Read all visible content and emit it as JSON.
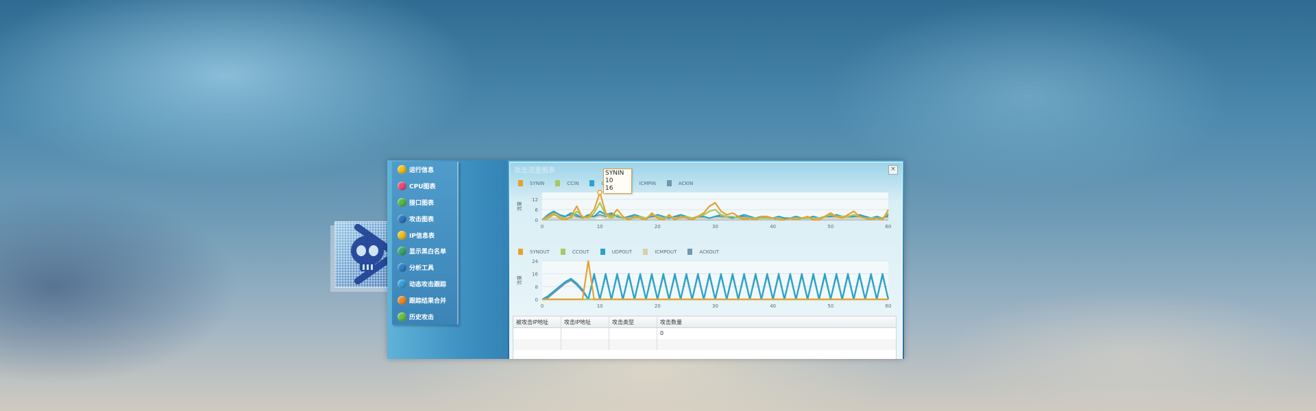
{
  "sidebar": {
    "items": [
      {
        "label": "运行信息",
        "icon": "run-info-icon",
        "color": "#f0c020"
      },
      {
        "label": "CPU图表",
        "icon": "cpu-chart-icon",
        "color": "#e0507a"
      },
      {
        "label": "接口图表",
        "icon": "interface-chart-icon",
        "color": "#58b848"
      },
      {
        "label": "攻击图表",
        "icon": "attack-chart-icon",
        "color": "#2f78c0"
      },
      {
        "label": "IP信息表",
        "icon": "ip-table-icon",
        "color": "#f0c020"
      },
      {
        "label": "显示黑白名单",
        "icon": "blacklist-icon",
        "color": "#3aa86a"
      },
      {
        "label": "分析工具",
        "icon": "analysis-tool-icon",
        "color": "#2f7fc8"
      },
      {
        "label": "动态攻击跟踪",
        "icon": "attack-tracking-icon",
        "color": "#3aa0d8"
      },
      {
        "label": "跟踪结果合并",
        "icon": "merge-results-icon",
        "color": "#f08a28"
      },
      {
        "label": "历史攻击",
        "icon": "history-attack-icon",
        "color": "#6cc040"
      }
    ]
  },
  "panel": {
    "title": "攻击流量图表",
    "close": "×"
  },
  "tooltip": {
    "series": "SYNIN",
    "x": "10",
    "y": "16"
  },
  "colors": {
    "orange": "#e8a030",
    "green": "#a8c860",
    "cyan": "#28a4cc",
    "beige": "#d8d0a8",
    "slate": "#6f98ae"
  },
  "chart_data": [
    {
      "type": "line",
      "title": "",
      "ylabel": "流量",
      "xlim": [
        0,
        60
      ],
      "ylim": [
        0,
        16
      ],
      "yticks": [
        0,
        6,
        12
      ],
      "xticks": [
        0,
        10,
        20,
        30,
        40,
        50,
        60
      ],
      "x": [
        0,
        1,
        2,
        3,
        4,
        5,
        6,
        7,
        8,
        9,
        10,
        11,
        12,
        13,
        14,
        15,
        16,
        17,
        18,
        19,
        20,
        21,
        22,
        23,
        24,
        25,
        26,
        27,
        28,
        29,
        30,
        31,
        32,
        33,
        34,
        35,
        36,
        37,
        38,
        39,
        40,
        41,
        42,
        43,
        44,
        45,
        46,
        47,
        48,
        49,
        50,
        51,
        52,
        53,
        54,
        55,
        56,
        57,
        58,
        59,
        60
      ],
      "series": [
        {
          "name": "SYNIN",
          "color": "#e8a030",
          "values": [
            0,
            2,
            4,
            1,
            0,
            2,
            8,
            1,
            2,
            6,
            16,
            4,
            2,
            6,
            2,
            0,
            2,
            1,
            0,
            4,
            1,
            0,
            3,
            0,
            2,
            1,
            0,
            2,
            4,
            8,
            10,
            5,
            3,
            4,
            2,
            0,
            1,
            0,
            2,
            2,
            1,
            0,
            0,
            1,
            0,
            1,
            2,
            0,
            0,
            2,
            4,
            2,
            1,
            3,
            5,
            2,
            1,
            0,
            1,
            0,
            6
          ]
        },
        {
          "name": "CCIN",
          "color": "#a8c860",
          "values": [
            0,
            1,
            3,
            2,
            1,
            1,
            5,
            2,
            1,
            4,
            10,
            3,
            1,
            3,
            1,
            1,
            1,
            2,
            1,
            3,
            2,
            1,
            2,
            1,
            1,
            2,
            1,
            2,
            3,
            5,
            6,
            3,
            2,
            2,
            1,
            1,
            1,
            1,
            1,
            1,
            1,
            1,
            0,
            1,
            1,
            1,
            1,
            1,
            1,
            2,
            3,
            2,
            2,
            2,
            3,
            2,
            1,
            1,
            1,
            1,
            4
          ]
        },
        {
          "name": "UDPIN",
          "color": "#28a4cc",
          "values": [
            0,
            3,
            5,
            3,
            2,
            4,
            3,
            1,
            3,
            2,
            5,
            3,
            4,
            2,
            1,
            2,
            3,
            2,
            1,
            2,
            3,
            2,
            1,
            2,
            3,
            2,
            1,
            2,
            2,
            1,
            2,
            3,
            2,
            1,
            2,
            3,
            2,
            1,
            2,
            1,
            1,
            2,
            1,
            1,
            2,
            1,
            1,
            2,
            1,
            2,
            2,
            3,
            2,
            2,
            2,
            3,
            2,
            1,
            2,
            1,
            3
          ]
        },
        {
          "name": "ICMPIN",
          "color": "#d8d0a8",
          "values": [
            0,
            1,
            1,
            1,
            1,
            1,
            1,
            1,
            1,
            1,
            2,
            1,
            1,
            1,
            1,
            1,
            1,
            1,
            1,
            1,
            1,
            1,
            1,
            1,
            1,
            1,
            1,
            1,
            1,
            1,
            1,
            1,
            1,
            1,
            1,
            1,
            1,
            1,
            1,
            1,
            1,
            1,
            1,
            1,
            1,
            1,
            1,
            1,
            1,
            1,
            1,
            1,
            1,
            1,
            1,
            1,
            1,
            1,
            1,
            1,
            1
          ]
        },
        {
          "name": "ACKIN",
          "color": "#6f98ae",
          "values": [
            0,
            2,
            3,
            2,
            2,
            3,
            2,
            1,
            2,
            2,
            3,
            2,
            3,
            2,
            1,
            2,
            2,
            1,
            1,
            2,
            2,
            1,
            1,
            2,
            2,
            1,
            1,
            2,
            1,
            1,
            2,
            2,
            1,
            1,
            2,
            2,
            1,
            1,
            2,
            1,
            1,
            2,
            1,
            1,
            2,
            1,
            1,
            2,
            1,
            2,
            2,
            2,
            2,
            1,
            2,
            2,
            2,
            1,
            1,
            1,
            2
          ]
        }
      ]
    },
    {
      "type": "line",
      "title": "",
      "ylabel": "流量",
      "xlim": [
        0,
        60
      ],
      "ylim": [
        0,
        24
      ],
      "yticks": [
        0,
        8,
        16,
        24
      ],
      "xticks": [
        0,
        10,
        20,
        30,
        40,
        50,
        60
      ],
      "x": [
        0,
        1,
        2,
        3,
        4,
        5,
        6,
        7,
        8,
        9,
        10,
        11,
        12,
        13,
        14,
        15,
        16,
        17,
        18,
        19,
        20,
        21,
        22,
        23,
        24,
        25,
        26,
        27,
        28,
        29,
        30,
        31,
        32,
        33,
        34,
        35,
        36,
        37,
        38,
        39,
        40,
        41,
        42,
        43,
        44,
        45,
        46,
        47,
        48,
        49,
        50,
        51,
        52,
        53,
        54,
        55,
        56,
        57,
        58,
        59,
        60
      ],
      "series": [
        {
          "name": "SYNOUT",
          "color": "#e8a030",
          "values": [
            0,
            0,
            0,
            0,
            0,
            0,
            0,
            0,
            24,
            0,
            0,
            0,
            0,
            0,
            0,
            0,
            0,
            0,
            0,
            0,
            0,
            0,
            0,
            0,
            0,
            0,
            0,
            0,
            0,
            0,
            0,
            0,
            0,
            0,
            0,
            0,
            0,
            0,
            0,
            0,
            0,
            0,
            0,
            0,
            0,
            0,
            0,
            0,
            0,
            0,
            0,
            0,
            0,
            0,
            0,
            0,
            0,
            0,
            0,
            0,
            0
          ]
        },
        {
          "name": "CCOUT",
          "color": "#a8c860",
          "values": [
            0,
            0,
            0,
            0,
            0,
            0,
            0,
            0,
            0,
            0,
            0,
            0,
            0,
            0,
            0,
            0,
            0,
            0,
            0,
            0,
            0,
            0,
            0,
            0,
            0,
            0,
            0,
            0,
            0,
            0,
            0,
            0,
            0,
            0,
            0,
            0,
            0,
            0,
            0,
            0,
            0,
            0,
            0,
            0,
            0,
            0,
            0,
            0,
            0,
            0,
            0,
            0,
            0,
            0,
            0,
            0,
            0,
            0,
            0,
            0,
            0
          ]
        },
        {
          "name": "UDPOUT",
          "color": "#28a4cc",
          "values": [
            0,
            2,
            5,
            8,
            11,
            13,
            10,
            6,
            0,
            16,
            0,
            16,
            0,
            16,
            0,
            16,
            0,
            16,
            0,
            16,
            0,
            16,
            0,
            16,
            0,
            16,
            0,
            16,
            0,
            16,
            0,
            16,
            0,
            16,
            0,
            16,
            0,
            16,
            0,
            16,
            0,
            16,
            0,
            16,
            0,
            16,
            0,
            16,
            0,
            16,
            0,
            16,
            0,
            16,
            0,
            16,
            0,
            16,
            0,
            16,
            0
          ]
        },
        {
          "name": "ICMPOUT",
          "color": "#d8d0a8",
          "values": [
            0,
            0,
            0,
            0,
            0,
            0,
            0,
            0,
            0,
            0,
            0,
            0,
            0,
            0,
            0,
            0,
            0,
            0,
            0,
            0,
            0,
            0,
            0,
            0,
            0,
            0,
            0,
            0,
            0,
            0,
            0,
            0,
            0,
            0,
            0,
            0,
            0,
            0,
            0,
            0,
            0,
            0,
            0,
            0,
            0,
            0,
            0,
            0,
            0,
            0,
            0,
            0,
            0,
            0,
            0,
            0,
            0,
            0,
            0,
            0,
            0
          ]
        },
        {
          "name": "ACKOUT",
          "color": "#6f98ae",
          "values": [
            0,
            1,
            4,
            7,
            10,
            12,
            9,
            5,
            0,
            15,
            0,
            15,
            0,
            15,
            0,
            15,
            0,
            15,
            0,
            15,
            0,
            15,
            0,
            15,
            0,
            15,
            0,
            15,
            0,
            15,
            0,
            15,
            0,
            15,
            0,
            15,
            0,
            15,
            0,
            15,
            0,
            15,
            0,
            15,
            0,
            15,
            0,
            15,
            0,
            15,
            0,
            15,
            0,
            15,
            0,
            15,
            0,
            15,
            0,
            15,
            0
          ]
        }
      ]
    }
  ],
  "table": {
    "headers": [
      "被攻击IP地址",
      "攻击IP地址",
      "攻击类型",
      "攻击数量"
    ],
    "rows": [
      [
        "",
        "",
        "",
        "0"
      ],
      [
        "",
        "",
        "",
        ""
      ]
    ]
  }
}
